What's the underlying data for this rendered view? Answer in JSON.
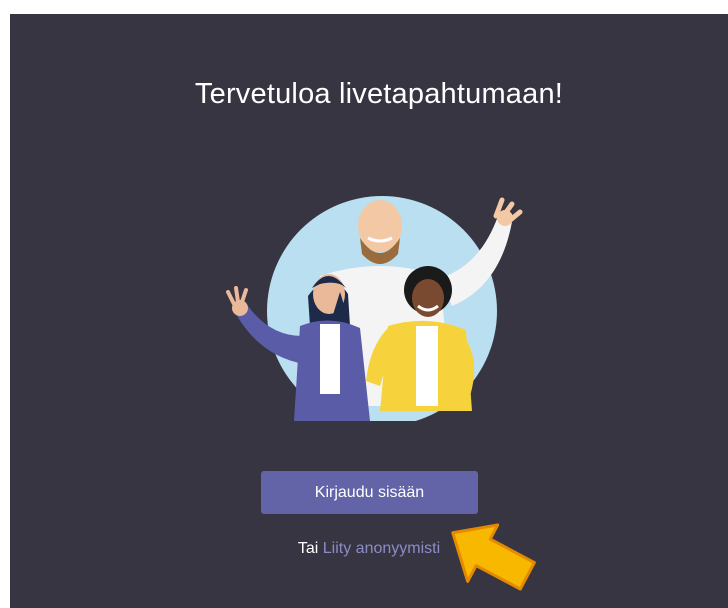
{
  "page": {
    "title": "Tervetuloa livetapahtumaan!",
    "signin_label": "Kirjaudu sisään",
    "alt_prefix": "Tai ",
    "anonymous_link": "Liity anonyymisti"
  },
  "colors": {
    "background": "#373541",
    "button": "#6264a7",
    "link": "#8b8cc7",
    "arrow": "#f9b800"
  },
  "icons": {
    "illustration": "people-waving-illustration",
    "pointer": "arrow-pointer-icon"
  }
}
